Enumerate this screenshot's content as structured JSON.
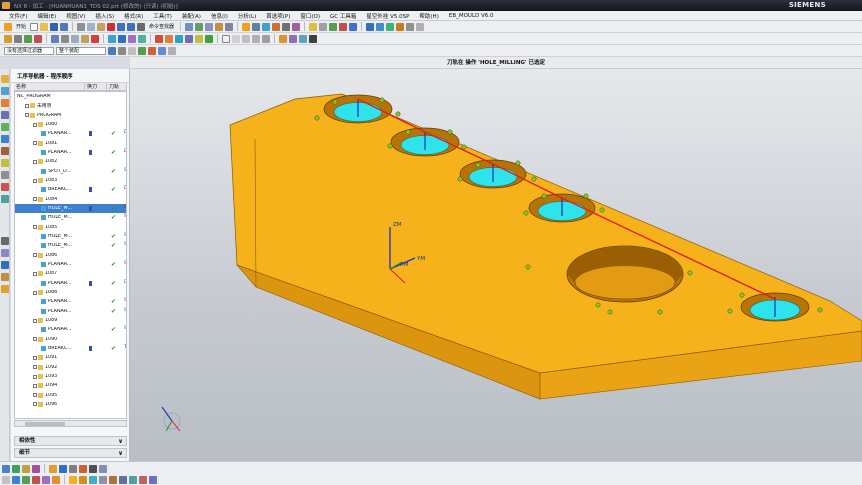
{
  "window": {
    "title": "NX 8 - 加工 - [HUANHUAN1_TDS 02.prt  (修改的)  (只读)  (初始)]",
    "brand": "SIEMENS"
  },
  "menu": [
    "文件(F)",
    "编辑(E)",
    "视图(V)",
    "插入(S)",
    "格式(R)",
    "工具(T)",
    "装配(A)",
    "信息(I)",
    "分析(L)",
    "首选项(P)",
    "窗口(O)",
    "GC 工具箱",
    "星空外挂 V5.0SP",
    "帮助(H)",
    "EB_MOULD V6.0"
  ],
  "toolbar": {
    "start_label": "开始",
    "command_finder_label": "命令查找器",
    "filter_select": "没有选择过滤器",
    "assembly_select": "整个装配"
  },
  "status_message": "刀轨在 操作 'HOLE_MILLING' 已选定",
  "navigator": {
    "title": "工序导航器 - 程序顺序",
    "columns": [
      "名称",
      "换刀",
      "刀轨"
    ],
    "rows": [
      {
        "name": "NC_PROGRAM",
        "level": 0,
        "icon": "none",
        "check": false,
        "path": false,
        "extra": ""
      },
      {
        "name": "未用项",
        "level": 1,
        "icon": "folder",
        "check": false,
        "path": false,
        "extra": ""
      },
      {
        "name": "PROGRAM",
        "level": 1,
        "icon": "folder",
        "check": false,
        "path": false,
        "extra": ""
      },
      {
        "name": "1080",
        "level": 2,
        "icon": "folder",
        "check": false,
        "path": false,
        "extra": ""
      },
      {
        "name": "PLANAR...",
        "level": 3,
        "icon": "op",
        "check": true,
        "path": true,
        "extra": "D"
      },
      {
        "name": "1081",
        "level": 2,
        "icon": "folder",
        "check": false,
        "path": false,
        "extra": ""
      },
      {
        "name": "PLANAR...",
        "level": 3,
        "icon": "op",
        "check": true,
        "path": true,
        "extra": "D"
      },
      {
        "name": "1082",
        "level": 2,
        "icon": "folder",
        "check": false,
        "path": false,
        "extra": ""
      },
      {
        "name": "SPOT_D...",
        "level": 3,
        "icon": "op",
        "check": true,
        "path": false,
        "extra": "S"
      },
      {
        "name": "1083",
        "level": 2,
        "icon": "folder",
        "check": false,
        "path": false,
        "extra": ""
      },
      {
        "name": "BREAKC...",
        "level": 3,
        "icon": "op",
        "check": true,
        "path": true,
        "extra": "D"
      },
      {
        "name": "1084",
        "level": 2,
        "icon": "folder",
        "check": false,
        "path": false,
        "extra": ""
      },
      {
        "name": "HOLE_M...",
        "level": 3,
        "icon": "op",
        "check": true,
        "path": true,
        "extra": "D",
        "selected": true
      },
      {
        "name": "HOLE_M...",
        "level": 3,
        "icon": "op",
        "check": true,
        "path": false,
        "extra": "S"
      },
      {
        "name": "1085",
        "level": 2,
        "icon": "folder",
        "check": false,
        "path": false,
        "extra": ""
      },
      {
        "name": "HOLE_M...",
        "level": 3,
        "icon": "op",
        "check": true,
        "path": false,
        "extra": "S"
      },
      {
        "name": "HOLE_M...",
        "level": 3,
        "icon": "op",
        "check": true,
        "path": false,
        "extra": "S"
      },
      {
        "name": "1086",
        "level": 2,
        "icon": "folder",
        "check": false,
        "path": false,
        "extra": ""
      },
      {
        "name": "PLANAR...",
        "level": 3,
        "icon": "op",
        "check": true,
        "path": false,
        "extra": "S"
      },
      {
        "name": "1087",
        "level": 2,
        "icon": "folder",
        "check": false,
        "path": false,
        "extra": ""
      },
      {
        "name": "PLANAR...",
        "level": 3,
        "icon": "op",
        "check": true,
        "path": true,
        "extra": "D"
      },
      {
        "name": "1088",
        "level": 2,
        "icon": "folder",
        "check": false,
        "path": false,
        "extra": ""
      },
      {
        "name": "PLANAR...",
        "level": 3,
        "icon": "op",
        "check": true,
        "path": false,
        "extra": "S"
      },
      {
        "name": "PLANAR...",
        "level": 3,
        "icon": "op",
        "check": true,
        "path": false,
        "extra": "S"
      },
      {
        "name": "1089",
        "level": 2,
        "icon": "folder",
        "check": false,
        "path": false,
        "extra": ""
      },
      {
        "name": "PLANAR...",
        "level": 3,
        "icon": "op",
        "check": true,
        "path": false,
        "extra": "S"
      },
      {
        "name": "1090",
        "level": 2,
        "icon": "folder",
        "check": false,
        "path": false,
        "extra": ""
      },
      {
        "name": "BREAKC...",
        "level": 3,
        "icon": "op",
        "check": true,
        "path": true,
        "extra": "T"
      },
      {
        "name": "1091",
        "level": 2,
        "icon": "folder",
        "check": false,
        "path": false,
        "extra": ""
      },
      {
        "name": "1092",
        "level": 2,
        "icon": "folder",
        "check": false,
        "path": false,
        "extra": ""
      },
      {
        "name": "1093",
        "level": 2,
        "icon": "folder",
        "check": false,
        "path": false,
        "extra": ""
      },
      {
        "name": "1094",
        "level": 2,
        "icon": "folder",
        "check": false,
        "path": false,
        "extra": ""
      },
      {
        "name": "1095",
        "level": 2,
        "icon": "folder",
        "check": false,
        "path": false,
        "extra": ""
      },
      {
        "name": "1096",
        "level": 2,
        "icon": "folder",
        "check": false,
        "path": false,
        "extra": ""
      }
    ],
    "panels": [
      "相依性",
      "细节"
    ]
  },
  "triad_labels": {
    "zm": "ZM",
    "xm": "XM",
    "ym": "YM"
  },
  "colors": {
    "part_top": "#f6b21b",
    "part_side_dark": "#d9900e",
    "part_side_front": "#eda314",
    "hole_cyan": "#2fe3ea",
    "toolpath_red": "#e0201f",
    "selected_row": "#3e7fd0"
  }
}
